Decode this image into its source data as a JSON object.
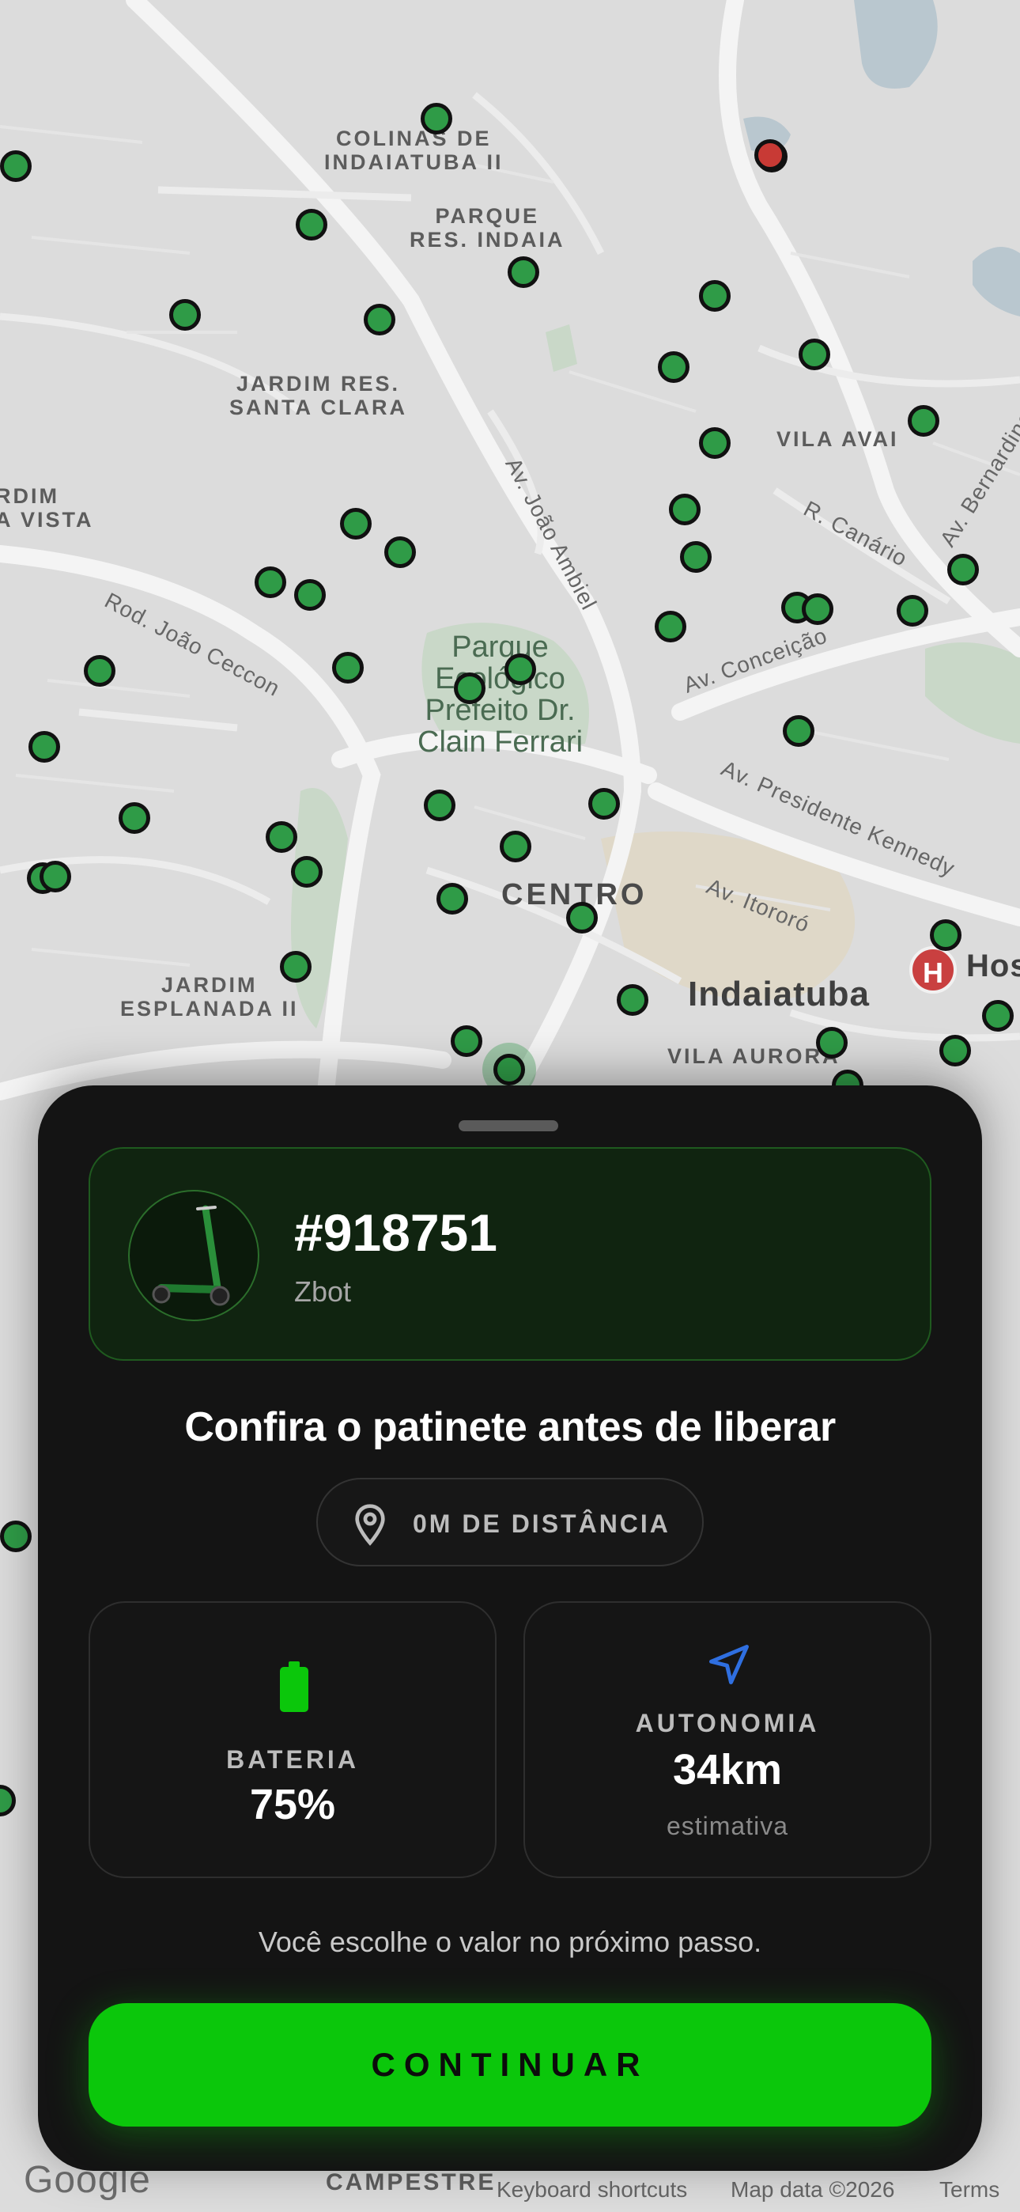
{
  "map": {
    "labels": {
      "colinas": "COLINAS DE\nINDAIATUBA II",
      "parque_res": "PARQUE\nRES. INDAIA",
      "jardim_santa_clara": "JARDIM RES.\nSANTA CLARA",
      "jardim_vista": "RDIM\nA VISTA",
      "vila_avai": "VILA AVAI",
      "av_joao_ambiel": "Av. João Ambiel",
      "r_canario": "R. Canário",
      "av_bernardino": "Av. Bernardino",
      "rod_joao_ceccon": "Rod. João Ceccon",
      "parque_ecologico": "Parque\nEcológico\nPrefeito Dr.\nClain Ferrari",
      "av_conceicao": "Av. Conceição",
      "av_presidente_kennedy": "Av. Presidente Kennedy",
      "av_itororo": "Av. Itororó",
      "centro": "CENTRO",
      "indaiatuba": "Indaiatuba",
      "jardim_esplanada": "JARDIM\nESPLANADA II",
      "vila_aurora": "VILA AURORA",
      "hosp": "Hos",
      "campestre": "CAMPESTRE"
    },
    "hospital_letter": "H",
    "footer": {
      "google": "Google",
      "keyboard": "Keyboard shortcuts",
      "mapdata": "Map data ©2026",
      "terms": "Terms"
    }
  },
  "vehicle": {
    "id": "#918751",
    "model": "Zbot"
  },
  "sheet": {
    "title": "Confira o patinete antes de liberar",
    "distance": "0M DE DISTÂNCIA",
    "battery": {
      "label": "BATERIA",
      "value": "75%"
    },
    "range": {
      "label": "AUTONOMIA",
      "value": "34km",
      "sub": "estimativa"
    },
    "note": "Você escolhe o valor no próximo passo.",
    "cta": "CONTINUAR"
  },
  "colors": {
    "accent": "#0bc70b",
    "pin_green": "#2f9b47",
    "pin_red": "#c83a35",
    "sheet_bg": "#141414",
    "range_icon": "#2f6fe0"
  },
  "icons": [
    "location-pin-icon",
    "battery-icon",
    "navigation-arrow-icon",
    "scooter-image",
    "hospital-icon"
  ]
}
